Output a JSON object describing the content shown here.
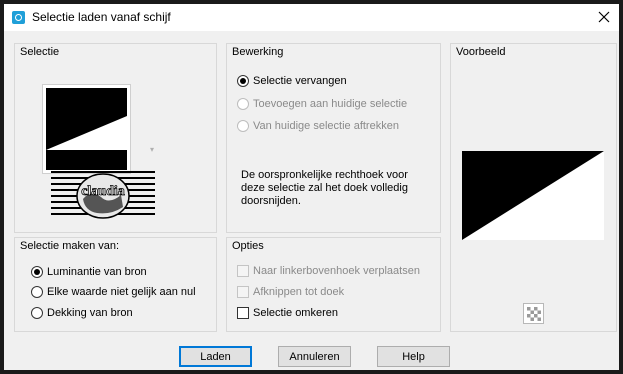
{
  "window": {
    "title": "Selectie laden vanaf schijf",
    "icon": "camera-icon",
    "close_glyph": "✕"
  },
  "selectie": {
    "title": "Selectie",
    "dropdown_glyph": "▾",
    "logo_text": "claudia"
  },
  "bewerking": {
    "title": "Bewerking",
    "options": [
      {
        "label": "Selectie vervangen",
        "checked": true,
        "enabled": true
      },
      {
        "label": "Toevoegen aan huidige selectie",
        "checked": false,
        "enabled": false
      },
      {
        "label": "Van huidige selectie aftrekken",
        "checked": false,
        "enabled": false
      }
    ],
    "info": "De oorspronkelijke rechthoek voor deze selectie zal het doek volledig doorsnijden."
  },
  "voorbeeld": {
    "title": "Voorbeeld"
  },
  "maken_van": {
    "title": "Selectie maken van:",
    "options": [
      {
        "label": "Luminantie van bron",
        "checked": true
      },
      {
        "label": "Elke waarde niet gelijk aan nul",
        "checked": false
      },
      {
        "label": "Dekking van bron",
        "checked": false
      }
    ]
  },
  "opties": {
    "title": "Opties",
    "items": [
      {
        "label": "Naar linkerbovenhoek verplaatsen",
        "checked": false,
        "enabled": false
      },
      {
        "label": "Afknippen tot doek",
        "checked": false,
        "enabled": false
      },
      {
        "label": "Selectie omkeren",
        "checked": false,
        "enabled": true
      }
    ]
  },
  "buttons": {
    "load": "Laden",
    "cancel": "Annuleren",
    "help": "Help"
  },
  "colors": {
    "accent": "#0078d7",
    "icon": "#1f9fd8"
  }
}
